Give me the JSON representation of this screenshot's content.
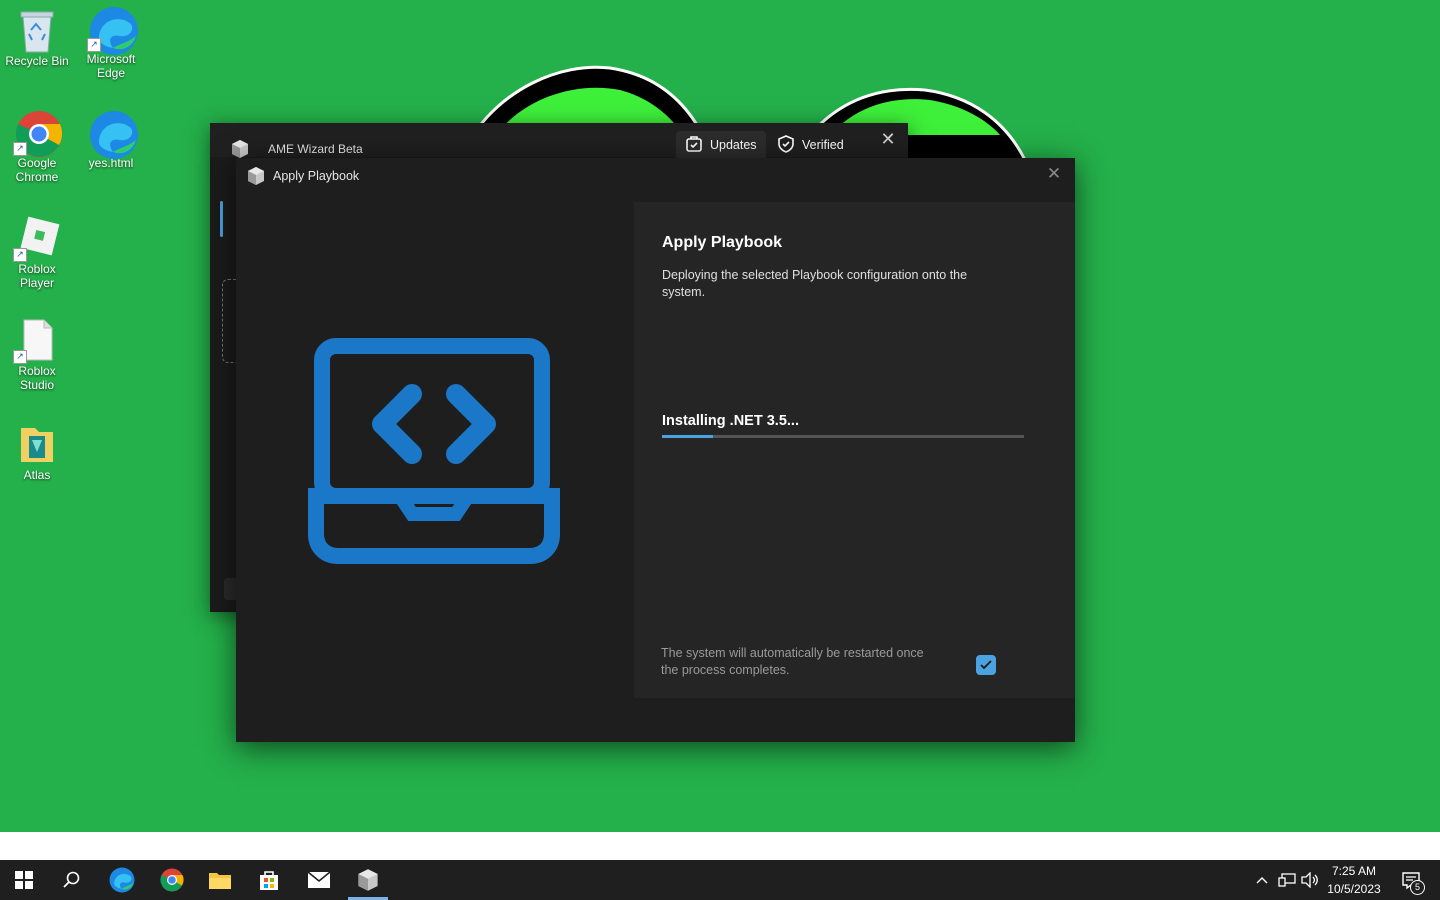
{
  "desktop": {
    "icons": [
      {
        "label": "Recycle Bin"
      },
      {
        "label": "Microsoft Edge"
      },
      {
        "label": "Google Chrome"
      },
      {
        "label": "yes.html"
      },
      {
        "label": "Roblox Player"
      },
      {
        "label": "Roblox Studio"
      },
      {
        "label": "Atlas"
      }
    ]
  },
  "background_window": {
    "title": "AME Wizard Beta",
    "tabs": [
      {
        "label": "Updates",
        "icon": "updates-icon"
      },
      {
        "label": "Verified",
        "icon": "verified-shield-icon"
      }
    ],
    "close": "✕"
  },
  "dialog": {
    "title": "Apply Playbook",
    "close": "✕",
    "heading": "Apply Playbook",
    "description": "Deploying the selected Playbook configuration onto the system.",
    "status": "Installing .NET 3.5...",
    "progress_percent": 14,
    "restart_note": "The system will automatically be restarted once the process completes.",
    "restart_checked": true,
    "illustration_icon": "laptop-code-icon"
  },
  "taskbar": {
    "pinned": [
      "start-icon",
      "search-icon",
      "edge-icon",
      "chrome-icon",
      "file-explorer-icon",
      "store-icon",
      "mail-icon",
      "ame-wizard-icon"
    ],
    "time": "7:25 AM",
    "date": "10/5/2023",
    "notification_count": "5"
  },
  "colors": {
    "desktop_bg": "#24b04a",
    "accent": "#4aa3e0",
    "dialog_bg": "#1e1e1e",
    "panel_bg": "#252525"
  }
}
